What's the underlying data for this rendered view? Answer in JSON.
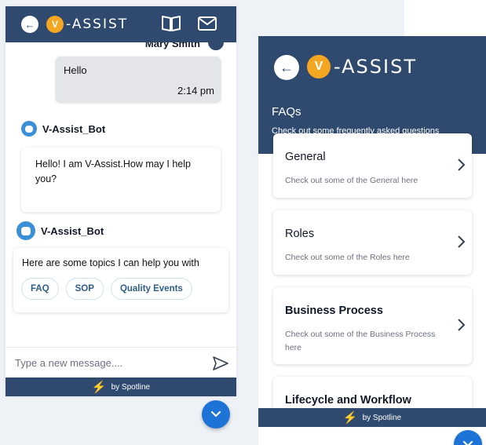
{
  "chat": {
    "app_name": "-ASSIST",
    "logo_letter": "V",
    "sender_name": "Mary Smith",
    "user_message": {
      "text": "Hello",
      "time": "2:14 pm"
    },
    "bot_name": "V-Assist_Bot",
    "bot_message_1": "Hello! I am V-Assist.How may I help you?",
    "bot_message_2": "Here are some topics I can help you with",
    "chips": [
      "FAQ",
      "SOP",
      "Quality Events"
    ],
    "input_placeholder": "Type a new message....",
    "footer_text": "by Spotline"
  },
  "faq": {
    "app_name": "-ASSIST",
    "logo_letter": "V",
    "title": "FAQs",
    "subtitle": "Check out some frequently asked questions",
    "cards": [
      {
        "title": "General",
        "desc": "Check out some of the General here"
      },
      {
        "title": "Roles",
        "desc": "Check out some of the Roles here"
      },
      {
        "title": "Business Process",
        "desc": "Check out some of the Business Process here"
      },
      {
        "title": "Lifecycle and Workflow",
        "desc": ""
      }
    ],
    "footer_text": "by Spotline"
  },
  "colors": {
    "header": "#2f4a6e",
    "accent": "#1d74d6",
    "logo_orange": "#f4a623",
    "bolt": "#f4b400"
  },
  "icons": [
    "back-arrow-icon",
    "book-icon",
    "mail-icon",
    "send-icon",
    "chevron-right-icon",
    "chevron-down-icon",
    "bolt-icon",
    "bot-icon"
  ]
}
